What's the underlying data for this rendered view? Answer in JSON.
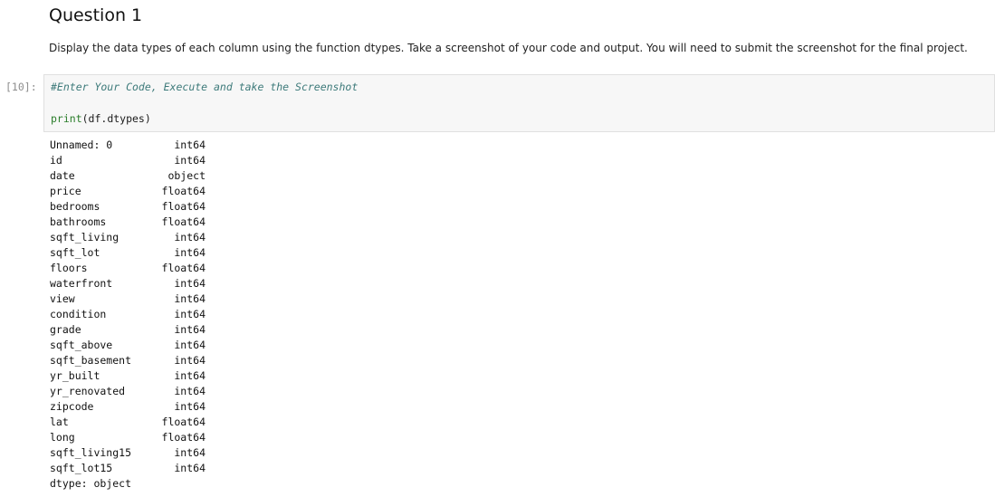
{
  "markdown": {
    "heading": "Question 1",
    "text": "Display the data types of each column using the function dtypes. Take a screenshot of your code and output. You will need to submit the screenshot for the final project."
  },
  "code_cell": {
    "prompt": "[10]:",
    "comment": "#Enter Your Code, Execute and take the Screenshot",
    "code_fn": "print",
    "code_args": "(df.dtypes)"
  },
  "output": {
    "rows": [
      {
        "name": "Unnamed: 0",
        "type": "int64"
      },
      {
        "name": "id",
        "type": "int64"
      },
      {
        "name": "date",
        "type": "object"
      },
      {
        "name": "price",
        "type": "float64"
      },
      {
        "name": "bedrooms",
        "type": "float64"
      },
      {
        "name": "bathrooms",
        "type": "float64"
      },
      {
        "name": "sqft_living",
        "type": "int64"
      },
      {
        "name": "sqft_lot",
        "type": "int64"
      },
      {
        "name": "floors",
        "type": "float64"
      },
      {
        "name": "waterfront",
        "type": "int64"
      },
      {
        "name": "view",
        "type": "int64"
      },
      {
        "name": "condition",
        "type": "int64"
      },
      {
        "name": "grade",
        "type": "int64"
      },
      {
        "name": "sqft_above",
        "type": "int64"
      },
      {
        "name": "sqft_basement",
        "type": "int64"
      },
      {
        "name": "yr_built",
        "type": "int64"
      },
      {
        "name": "yr_renovated",
        "type": "int64"
      },
      {
        "name": "zipcode",
        "type": "int64"
      },
      {
        "name": "lat",
        "type": "float64"
      },
      {
        "name": "long",
        "type": "float64"
      },
      {
        "name": "sqft_living15",
        "type": "int64"
      },
      {
        "name": "sqft_lot15",
        "type": "int64"
      }
    ],
    "footer": "dtype: object"
  },
  "colors": {
    "comment": "#3d7a7a",
    "builtin": "#2a7d2a",
    "cell_background": "#f7f7f7",
    "prompt": "#8e8e8e"
  }
}
